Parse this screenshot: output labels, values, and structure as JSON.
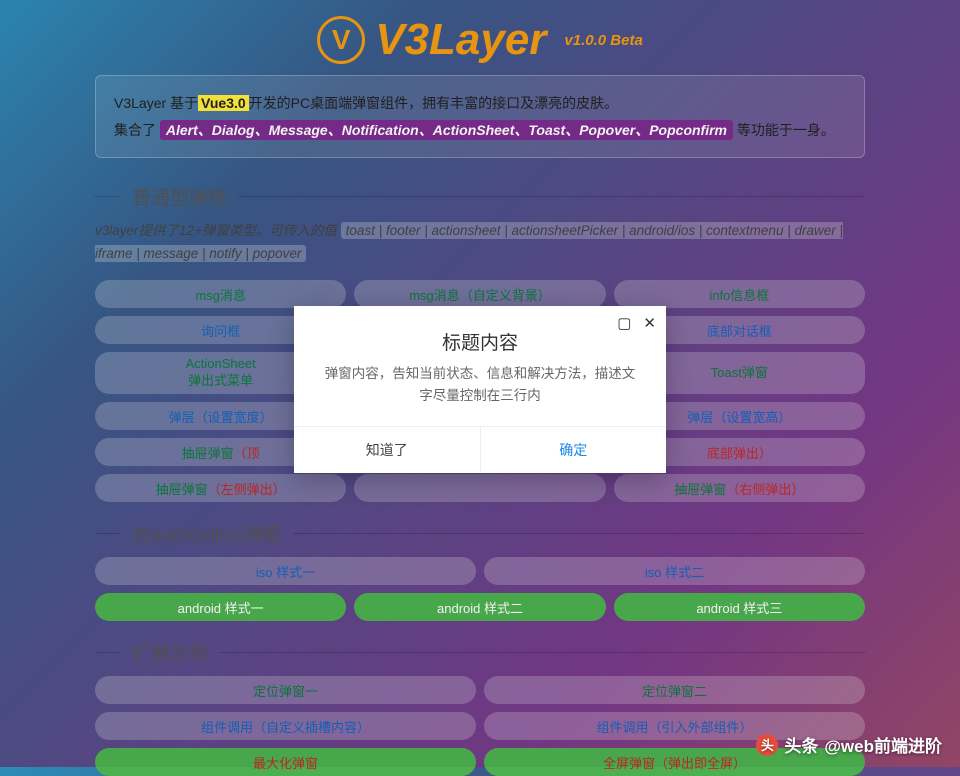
{
  "header": {
    "brand": "V3Layer",
    "version": "v1.0.0 Beta"
  },
  "intro": {
    "pre1": "V3Layer 基于",
    "hl_vue": "Vue3.0",
    "post1": "开发的PC桌面端弹窗组件，拥有丰富的接口及漂亮的皮肤。",
    "pre2": "集合了 ",
    "hl_types": "Alert、Dialog、Message、Notification、ActionSheet、Toast、Popover、Popconfirm",
    "post2": " 等功能于一身。"
  },
  "sections": {
    "normal": {
      "title": "普通型弹框",
      "desc_pre": "v3layer提供了12+弹窗类型。可传入的值 ",
      "desc_tag": "toast | footer | actionsheet | actionsheetPicker | android/ios | contextmenu | drawer | iframe | message | notify | popover",
      "row1": [
        "msg消息",
        "msg消息（自定义背景）",
        "info信息框"
      ],
      "row2": [
        "询问框",
        "",
        "底部对话框"
      ],
      "row3": [
        {
          "l1": "ActionSheet",
          "l2": "弹出式菜单"
        },
        {
          "l1": "",
          "l2": ""
        },
        {
          "l1": "Toast弹窗",
          "l2": ""
        }
      ],
      "row4": [
        "弹层（设置宽度）",
        "",
        "弹层（设置宽高）"
      ],
      "row5": [
        {
          "t": "抽屉弹窗",
          "p": "（顶"
        },
        {
          "t": "",
          "p": ""
        },
        {
          "t": "",
          "p": "底部弹出）"
        }
      ],
      "row6": [
        {
          "t": "抽屉弹窗",
          "p": "（左侧弹出）"
        },
        {
          "t": "",
          "p": ""
        },
        {
          "t": "抽屉弹窗",
          "p": "（右侧弹出）"
        }
      ]
    },
    "mobile": {
      "title": "仿android|ios弹框",
      "row1": [
        "iso 样式一",
        "iso 样式二"
      ],
      "row2": [
        "android 样式一",
        "android 样式二",
        "android 样式三"
      ]
    },
    "ext": {
      "title": "扩展示例",
      "row1": [
        "定位弹窗一",
        "定位弹窗二"
      ],
      "row2": [
        "组件调用（自定义插槽内容）",
        "组件调用（引入外部组件）"
      ],
      "row3": [
        {
          "t": "最大化弹窗",
          "p": ""
        },
        {
          "t": "全屏弹窗",
          "p": "（弹出即全屏）"
        }
      ]
    }
  },
  "modal": {
    "title": "标题内容",
    "body": "弹窗内容，告知当前状态、信息和解决方法，描述文字尽量控制在三行内",
    "cancel": "知道了",
    "ok": "确定"
  },
  "attribution": {
    "source": "头条",
    "author": "@web前端进阶"
  }
}
